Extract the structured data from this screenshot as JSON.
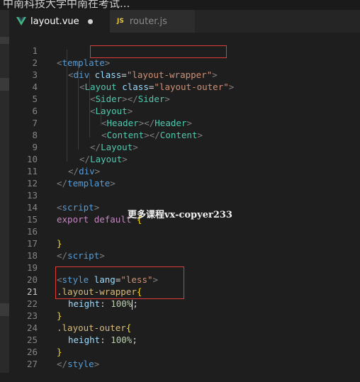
{
  "top_strip_text": "中南科技大学中南在考试...",
  "tabs": [
    {
      "label": "layout.vue",
      "icon": "vue-icon",
      "active": true,
      "dirty": true
    },
    {
      "label": "router.js",
      "icon": "js-icon",
      "icon_text": "JS",
      "active": false,
      "dirty": false
    }
  ],
  "line_numbers": [
    "1",
    "2",
    "3",
    "4",
    "5",
    "6",
    "7",
    "8",
    "9",
    "10",
    "11",
    "12",
    "13",
    "14",
    "15",
    "16",
    "17",
    "18",
    "19",
    "20",
    "21",
    "22",
    "23",
    "24",
    "25",
    "26",
    "27"
  ],
  "current_line": "21",
  "code": {
    "l1": {
      "open": "<",
      "tag": "template",
      "close": ">"
    },
    "l2": {
      "open": "<",
      "tag": "div",
      "attr": "class",
      "eq": "=",
      "val": "\"layout-wrapper\"",
      "close": ">"
    },
    "l3": {
      "open": "<",
      "tag": "Layout",
      "attr": "class",
      "eq": "=",
      "val": "\"layout-outer\"",
      "close": ">"
    },
    "l4": {
      "open": "<",
      "tag": "Sider",
      "mid": "></",
      "tag2": "Sider",
      "close": ">"
    },
    "l5": {
      "open": "<",
      "tag": "Layout",
      "close": ">"
    },
    "l6": {
      "open": "<",
      "tag": "Header",
      "mid": "></",
      "tag2": "Header",
      "close": ">"
    },
    "l7": {
      "open": "<",
      "tag": "Content",
      "mid": "></",
      "tag2": "Content",
      "close": ">"
    },
    "l8": {
      "open": "</",
      "tag": "Layout",
      "close": ">"
    },
    "l9": {
      "open": "</",
      "tag": "Layout",
      "close": ">"
    },
    "l10": {
      "open": "</",
      "tag": "div",
      "close": ">"
    },
    "l11": {
      "open": "</",
      "tag": "template",
      "close": ">"
    },
    "l13": {
      "open": "<",
      "tag": "script",
      "close": ">"
    },
    "l14": {
      "kw1": "export",
      "kw2": "default",
      "brace": "{"
    },
    "l16": {
      "brace": "}"
    },
    "l17": {
      "open": "</",
      "tag": "script",
      "close": ">"
    },
    "l19": {
      "open": "<",
      "tag": "style",
      "attr": "lang",
      "eq": "=",
      "val": "\"less\"",
      "close": ">"
    },
    "l20": {
      "sel": ".layout-wrapper",
      "brace": "{"
    },
    "l21": {
      "prop": "height",
      "colon": ":",
      "num": "100%",
      "semi": ";"
    },
    "l22": {
      "brace": "}"
    },
    "l23": {
      "sel": ".layout-outer",
      "brace": "{"
    },
    "l24": {
      "prop": "height",
      "colon": ":",
      "num": "100%",
      "semi": ";"
    },
    "l25": {
      "brace": "}"
    },
    "l26": {
      "open": "</",
      "tag": "style",
      "close": ">"
    }
  },
  "watermark": "更多课程vx-copyer233",
  "colors": {
    "background": "#1e1e1e",
    "tag": "#569cd6",
    "component": "#4ec9b0",
    "attribute": "#9cdcfe",
    "string": "#ce9178",
    "keyword": "#c586c0",
    "selector": "#d7ba7d",
    "highlight_box": "#e03a3a"
  }
}
